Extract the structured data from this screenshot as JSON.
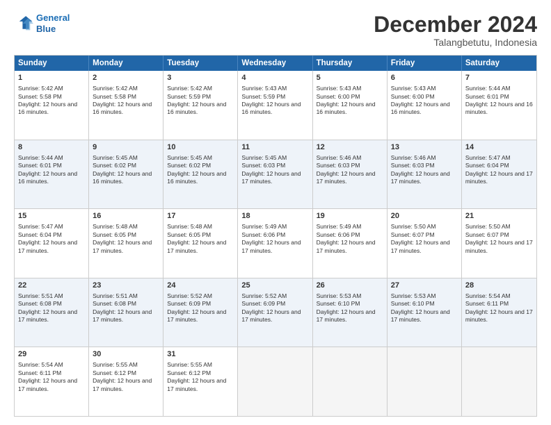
{
  "header": {
    "logo_line1": "General",
    "logo_line2": "Blue",
    "month_title": "December 2024",
    "location": "Talangbetutu, Indonesia"
  },
  "calendar": {
    "days_of_week": [
      "Sunday",
      "Monday",
      "Tuesday",
      "Wednesday",
      "Thursday",
      "Friday",
      "Saturday"
    ],
    "rows": [
      [
        {
          "day": "1",
          "sunrise": "5:42 AM",
          "sunset": "5:58 PM",
          "daylight": "12 hours and 16 minutes"
        },
        {
          "day": "2",
          "sunrise": "5:42 AM",
          "sunset": "5:58 PM",
          "daylight": "12 hours and 16 minutes"
        },
        {
          "day": "3",
          "sunrise": "5:42 AM",
          "sunset": "5:59 PM",
          "daylight": "12 hours and 16 minutes"
        },
        {
          "day": "4",
          "sunrise": "5:43 AM",
          "sunset": "5:59 PM",
          "daylight": "12 hours and 16 minutes"
        },
        {
          "day": "5",
          "sunrise": "5:43 AM",
          "sunset": "6:00 PM",
          "daylight": "12 hours and 16 minutes"
        },
        {
          "day": "6",
          "sunrise": "5:43 AM",
          "sunset": "6:00 PM",
          "daylight": "12 hours and 16 minutes"
        },
        {
          "day": "7",
          "sunrise": "5:44 AM",
          "sunset": "6:01 PM",
          "daylight": "12 hours and 16 minutes"
        }
      ],
      [
        {
          "day": "8",
          "sunrise": "5:44 AM",
          "sunset": "6:01 PM",
          "daylight": "12 hours and 16 minutes"
        },
        {
          "day": "9",
          "sunrise": "5:45 AM",
          "sunset": "6:02 PM",
          "daylight": "12 hours and 16 minutes"
        },
        {
          "day": "10",
          "sunrise": "5:45 AM",
          "sunset": "6:02 PM",
          "daylight": "12 hours and 16 minutes"
        },
        {
          "day": "11",
          "sunrise": "5:45 AM",
          "sunset": "6:03 PM",
          "daylight": "12 hours and 17 minutes"
        },
        {
          "day": "12",
          "sunrise": "5:46 AM",
          "sunset": "6:03 PM",
          "daylight": "12 hours and 17 minutes"
        },
        {
          "day": "13",
          "sunrise": "5:46 AM",
          "sunset": "6:03 PM",
          "daylight": "12 hours and 17 minutes"
        },
        {
          "day": "14",
          "sunrise": "5:47 AM",
          "sunset": "6:04 PM",
          "daylight": "12 hours and 17 minutes"
        }
      ],
      [
        {
          "day": "15",
          "sunrise": "5:47 AM",
          "sunset": "6:04 PM",
          "daylight": "12 hours and 17 minutes"
        },
        {
          "day": "16",
          "sunrise": "5:48 AM",
          "sunset": "6:05 PM",
          "daylight": "12 hours and 17 minutes"
        },
        {
          "day": "17",
          "sunrise": "5:48 AM",
          "sunset": "6:05 PM",
          "daylight": "12 hours and 17 minutes"
        },
        {
          "day": "18",
          "sunrise": "5:49 AM",
          "sunset": "6:06 PM",
          "daylight": "12 hours and 17 minutes"
        },
        {
          "day": "19",
          "sunrise": "5:49 AM",
          "sunset": "6:06 PM",
          "daylight": "12 hours and 17 minutes"
        },
        {
          "day": "20",
          "sunrise": "5:50 AM",
          "sunset": "6:07 PM",
          "daylight": "12 hours and 17 minutes"
        },
        {
          "day": "21",
          "sunrise": "5:50 AM",
          "sunset": "6:07 PM",
          "daylight": "12 hours and 17 minutes"
        }
      ],
      [
        {
          "day": "22",
          "sunrise": "5:51 AM",
          "sunset": "6:08 PM",
          "daylight": "12 hours and 17 minutes"
        },
        {
          "day": "23",
          "sunrise": "5:51 AM",
          "sunset": "6:08 PM",
          "daylight": "12 hours and 17 minutes"
        },
        {
          "day": "24",
          "sunrise": "5:52 AM",
          "sunset": "6:09 PM",
          "daylight": "12 hours and 17 minutes"
        },
        {
          "day": "25",
          "sunrise": "5:52 AM",
          "sunset": "6:09 PM",
          "daylight": "12 hours and 17 minutes"
        },
        {
          "day": "26",
          "sunrise": "5:53 AM",
          "sunset": "6:10 PM",
          "daylight": "12 hours and 17 minutes"
        },
        {
          "day": "27",
          "sunrise": "5:53 AM",
          "sunset": "6:10 PM",
          "daylight": "12 hours and 17 minutes"
        },
        {
          "day": "28",
          "sunrise": "5:54 AM",
          "sunset": "6:11 PM",
          "daylight": "12 hours and 17 minutes"
        }
      ],
      [
        {
          "day": "29",
          "sunrise": "5:54 AM",
          "sunset": "6:11 PM",
          "daylight": "12 hours and 17 minutes"
        },
        {
          "day": "30",
          "sunrise": "5:55 AM",
          "sunset": "6:12 PM",
          "daylight": "12 hours and 17 minutes"
        },
        {
          "day": "31",
          "sunrise": "5:55 AM",
          "sunset": "6:12 PM",
          "daylight": "12 hours and 17 minutes"
        },
        null,
        null,
        null,
        null
      ]
    ]
  }
}
